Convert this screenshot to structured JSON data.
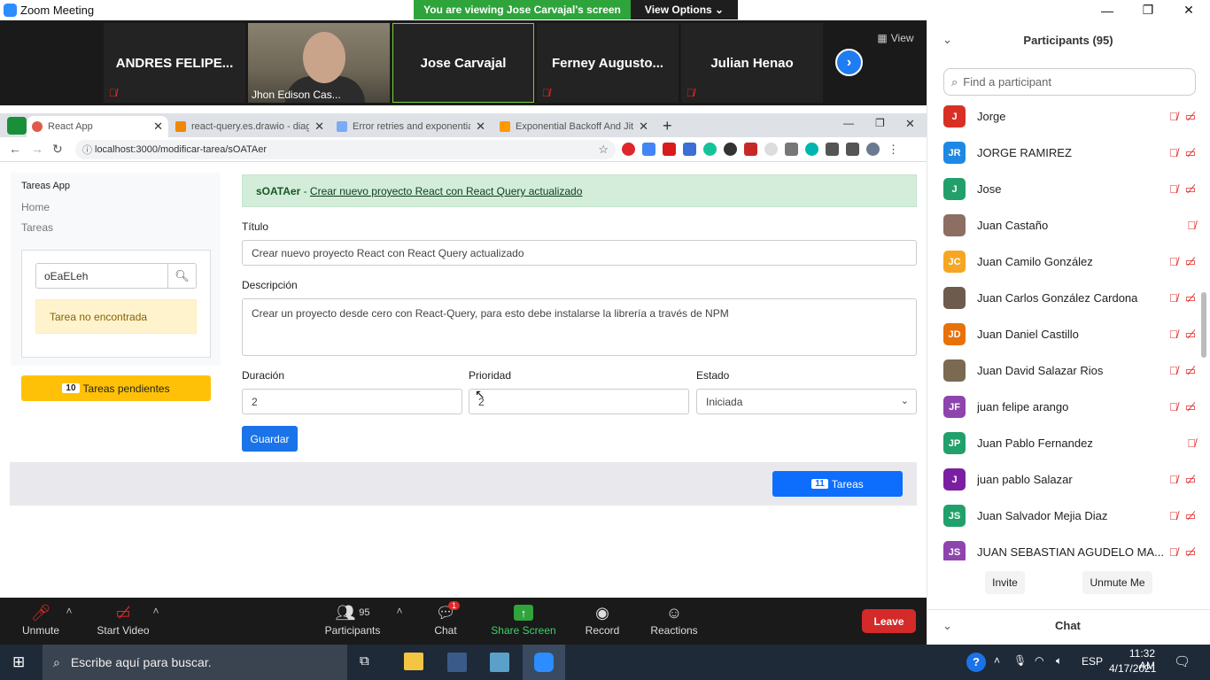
{
  "window": {
    "title": "Zoom Meeting",
    "banner": "You are viewing Jose Carvajal's screen",
    "view_options": "View Options ⌄"
  },
  "video": {
    "tiles": [
      {
        "name": "ANDRES  FELIPE..."
      },
      {
        "name": "Jhon Edison Cas..."
      },
      {
        "name": "Jose Carvajal"
      },
      {
        "name": "Ferney  Augusto..."
      },
      {
        "name": "Julian Henao"
      }
    ],
    "view_label": "View"
  },
  "browser": {
    "tabs": [
      {
        "title": "React App",
        "color": "#5bb974"
      },
      {
        "title": "react-query.es.drawio - diagrams",
        "color": "#f08705"
      },
      {
        "title": "Error retries and exponential bac",
        "color": "#4285f4"
      },
      {
        "title": "Exponential Backoff And Jitter | A",
        "color": "#ff9900"
      }
    ],
    "url": "localhost:3000/modificar-tarea/sOATAer"
  },
  "app": {
    "brand": "Tareas App",
    "nav": [
      "Home",
      "Tareas"
    ],
    "search_value": "oEaELeh",
    "not_found": "Tarea no encontrada",
    "pending_count": "10",
    "pending_label": "Tareas pendientes",
    "alert_id": "sOATAer",
    "alert_sep": " - ",
    "alert_link": "Crear nuevo proyecto React con React Query actualizado",
    "titulo_label": "Título",
    "titulo_value": "Crear nuevo proyecto React con React Query actualizado",
    "descripcion_label": "Descripción",
    "descripcion_value": "Crear un proyecto desde cero con React-Query, para esto debe instalarse la librería a través de NPM",
    "duracion_label": "Duración",
    "duracion_value": "2",
    "prioridad_label": "Prioridad",
    "prioridad_value": "2",
    "estado_label": "Estado",
    "estado_value": "Iniciada",
    "guardar": "Guardar",
    "tareas_count": "11",
    "tareas_label": "Tareas"
  },
  "participants": {
    "title": "Participants (95)",
    "find_placeholder": "Find a participant",
    "list": [
      {
        "initials": "J",
        "name": "Jorge",
        "color": "#d93025",
        "video_off": true
      },
      {
        "initials": "JR",
        "name": "JORGE RAMIREZ",
        "color": "#1e88e5",
        "video_off": true
      },
      {
        "initials": "J",
        "name": "Jose",
        "color": "#22a06b",
        "video_off": true
      },
      {
        "initials": "",
        "name": "Juan  Castaño",
        "color": "#8d6e63",
        "video_off": false
      },
      {
        "initials": "JC",
        "name": "Juan Camilo González",
        "color": "#f6a623",
        "video_off": true
      },
      {
        "initials": "",
        "name": "Juan Carlos González Cardona",
        "color": "#6d5c4d",
        "video_off": true
      },
      {
        "initials": "JD",
        "name": "Juan Daniel Castillo",
        "color": "#e8710a",
        "video_off": true
      },
      {
        "initials": "",
        "name": "Juan David Salazar Rios",
        "color": "#7a6a52",
        "video_off": true
      },
      {
        "initials": "JF",
        "name": "juan felipe arango",
        "color": "#8e44ad",
        "video_off": true
      },
      {
        "initials": "JP",
        "name": "Juan Pablo Fernandez",
        "color": "#22a06b",
        "video_off": false
      },
      {
        "initials": "J",
        "name": "juan pablo Salazar",
        "color": "#7b1fa2",
        "video_off": true
      },
      {
        "initials": "JS",
        "name": "Juan Salvador Mejia Diaz",
        "color": "#22a06b",
        "video_off": true
      },
      {
        "initials": "JS",
        "name": "JUAN SEBASTIAN AGUDELO MA...",
        "color": "#8e44ad",
        "video_off": true
      }
    ],
    "invite": "Invite",
    "unmute_me": "Unmute Me",
    "chat": "Chat"
  },
  "toolbar": {
    "unmute": "Unmute",
    "start_video": "Start Video",
    "participants": "Participants",
    "participants_count": "95",
    "chat": "Chat",
    "chat_badge": "1",
    "share_screen": "Share Screen",
    "record": "Record",
    "reactions": "Reactions",
    "leave": "Leave"
  },
  "taskbar": {
    "search": "Escribe aquí para buscar.",
    "lang": "ESP",
    "time": "11:32 AM",
    "date": "4/17/2021"
  }
}
